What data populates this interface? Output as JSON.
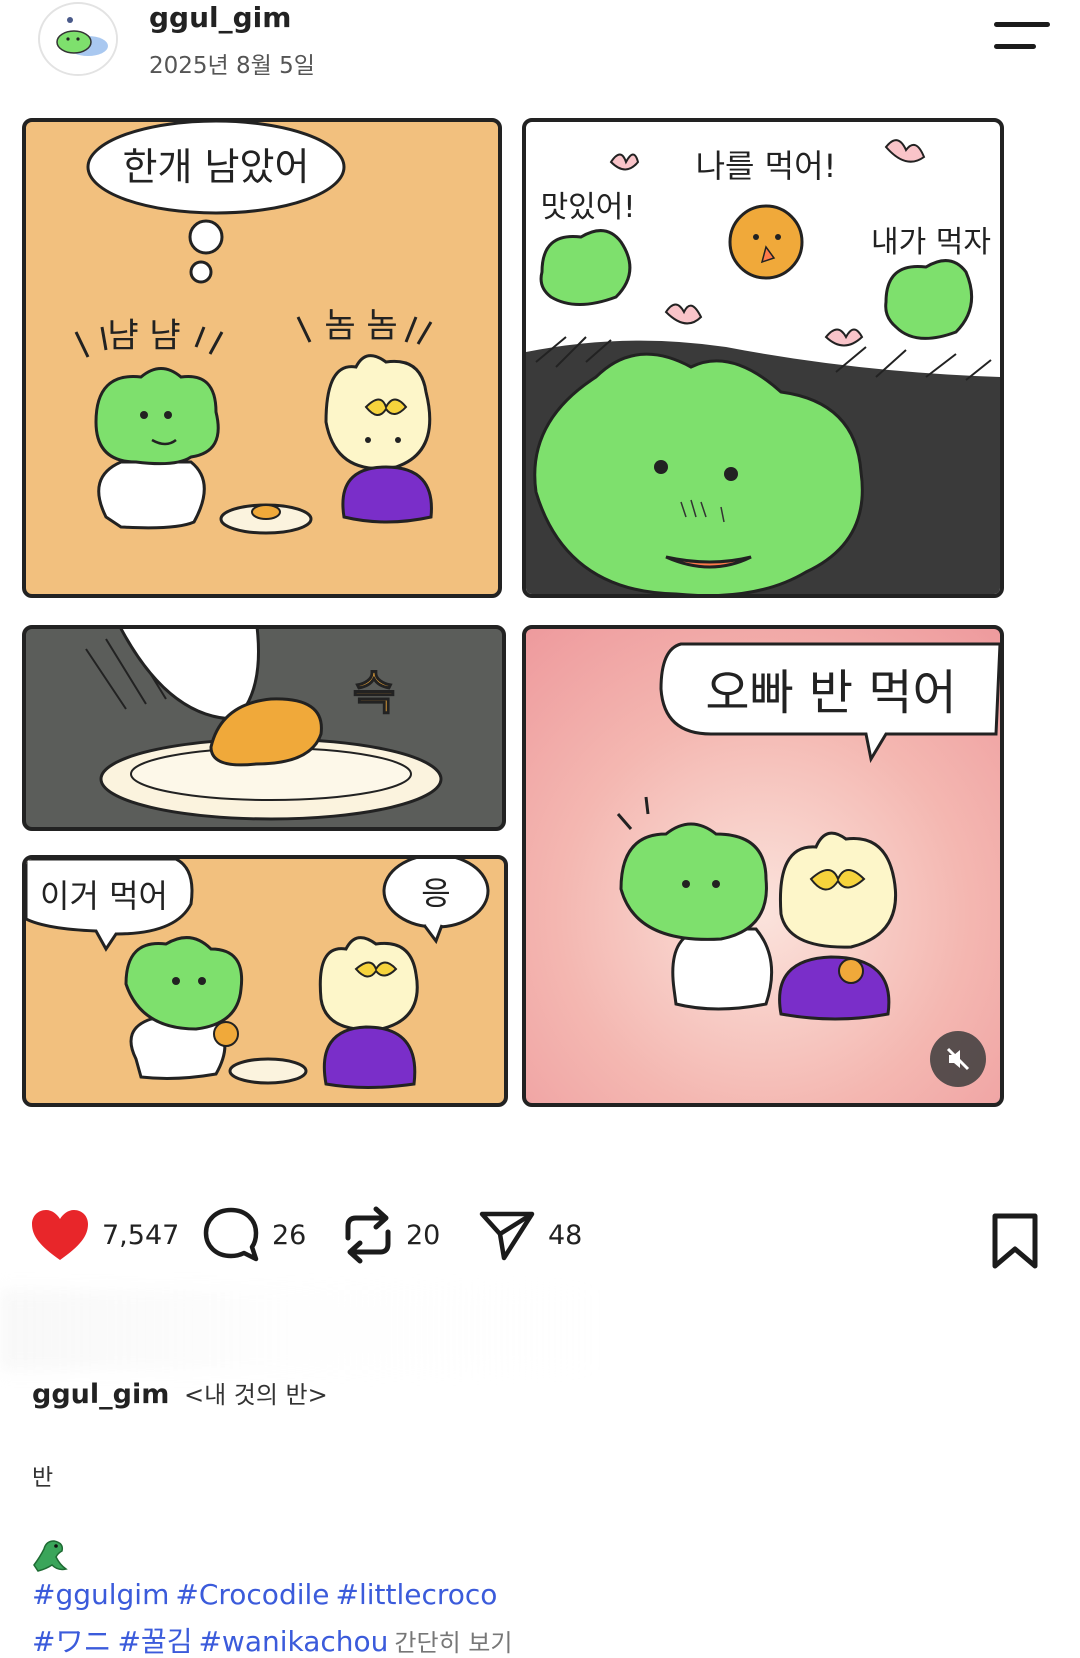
{
  "post": {
    "username": "ggul_gim",
    "date": "2025년 8월 5일"
  },
  "comic": {
    "panel1": {
      "bubble": "한개 남았어",
      "sfx_left": "냠 냠",
      "sfx_right": "놈 놈"
    },
    "panel2": {
      "left": "맛있어!",
      "center": "나를 먹어!",
      "right": "내가 먹자"
    },
    "panel3": {
      "sfx": "슥"
    },
    "panel4": {
      "left": "이거 먹어",
      "right": "응"
    },
    "panel5": {
      "bubble": "오빠 반 먹어"
    }
  },
  "actions": {
    "likes": "7,547",
    "comments": "26",
    "reposts": "20",
    "shares": "48"
  },
  "caption": {
    "username": "ggul_gim",
    "title": "<내 것의 반>",
    "body": "반",
    "tags_line1": [
      "#ggulgim",
      "#Crocodile",
      "#littlecroco"
    ],
    "tags_line2": [
      "#ワニ",
      "#꿀김",
      "#wanikachou"
    ],
    "more": "간단히 보기"
  },
  "colors": {
    "croc_green": "#7ee06d",
    "panel_orange": "#f2c07e",
    "panel_pink": "#f2a7a6",
    "heart_red": "#e8262a",
    "hashtag_blue": "#3b5bdb"
  },
  "icons": [
    "menu-icon",
    "heart-icon",
    "comment-icon",
    "repost-icon",
    "share-icon",
    "bookmark-icon",
    "mute-icon",
    "crocodile-emoji-icon"
  ]
}
